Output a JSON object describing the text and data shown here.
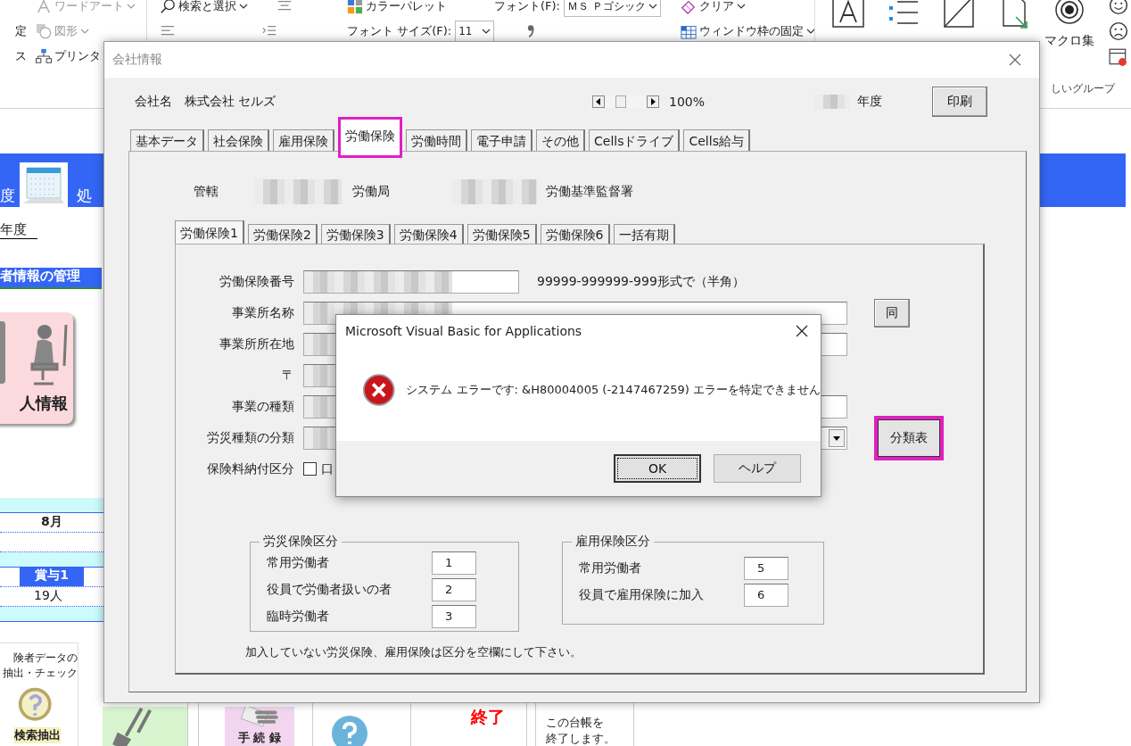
{
  "ribbon": {
    "cut_labels": [
      "定",
      "ス"
    ],
    "drawing_items": [
      {
        "kind": "wordart",
        "label": "ワードアート",
        "dropdown": true,
        "disabled": true
      },
      {
        "kind": "shapes",
        "label": "図形",
        "dropdown": true,
        "disabled": true
      },
      {
        "kind": "printer",
        "label": "プリンタ",
        "dropdown": false,
        "disabled": false
      }
    ],
    "search": "検索と選択",
    "palette": "カラーパレット",
    "font_label": "フォント(F):",
    "font_value": "ＭＳ Ｐゴシック",
    "size_label": "フォント サイズ(F):",
    "size_value": "11",
    "clear": "クリア",
    "freeze": "ウィンドウ枠の固定",
    "big_buttons": [
      {
        "kind": "letter"
      },
      {
        "kind": "list"
      },
      {
        "kind": "diagonal"
      },
      {
        "kind": "save"
      },
      {
        "kind": "target",
        "label": "マクロ集"
      }
    ],
    "group_label": "しいグループ"
  },
  "sheet": {
    "banner_left": "度",
    "banner_right": "処",
    "year": "年度",
    "section": "者情報の管理",
    "tile_caption": "人情報",
    "month": "8月",
    "bonus": "賞与1",
    "count": "19人",
    "search_tile": {
      "lines": [
        "険者データの",
        "抽出・チェック"
      ],
      "caption": "検索抽出"
    },
    "procedure_caption": "手 続 録",
    "end_title": "終了",
    "end_text": [
      "この台帳を",
      "終了します。"
    ]
  },
  "form": {
    "title": "会社情報",
    "company_label": "会社名",
    "company_name": "株式会社 セルズ",
    "zoom": "100%",
    "year_label": "年度",
    "print_button": "印刷",
    "tabs": [
      {
        "label": "基本データ",
        "selected": false,
        "highlighted": false
      },
      {
        "label": "社会保険",
        "selected": false,
        "highlighted": false
      },
      {
        "label": "雇用保険",
        "selected": false,
        "highlighted": false
      },
      {
        "label": "労働保険",
        "selected": true,
        "highlighted": true
      },
      {
        "label": "労働時間",
        "selected": false,
        "highlighted": false
      },
      {
        "label": "電子申請",
        "selected": false,
        "highlighted": false
      },
      {
        "label": "その他",
        "selected": false,
        "highlighted": false
      },
      {
        "label": "Cellsドライブ",
        "selected": false,
        "highlighted": false
      },
      {
        "label": "Cells給与",
        "selected": false,
        "highlighted": false
      }
    ],
    "jurisdiction": {
      "label": "管轄",
      "bureau": "労働局",
      "office": "労働基準監督署"
    },
    "sub_tabs": [
      {
        "label": "労働保険1",
        "selected": true
      },
      {
        "label": "労働保険2",
        "selected": false
      },
      {
        "label": "労働保険3",
        "selected": false
      },
      {
        "label": "労働保険4",
        "selected": false
      },
      {
        "label": "労働保険5",
        "selected": false
      },
      {
        "label": "労働保険6",
        "selected": false
      },
      {
        "label": "一括有期",
        "selected": false
      }
    ],
    "fields": [
      {
        "kind": "short",
        "label": "労働保険番号",
        "hint": "99999-999999-999形式で（半角）"
      },
      {
        "kind": "wide",
        "label": "事業所名称",
        "button": {
          "label": "同",
          "highlighted": false
        }
      },
      {
        "kind": "wide",
        "label": "事業所所在地"
      },
      {
        "kind": "postal",
        "label": "〒"
      },
      {
        "kind": "wide",
        "label": "事業の種類"
      },
      {
        "kind": "select",
        "label": "労災種類の分類",
        "button": {
          "label": "分類表",
          "highlighted": true
        }
      },
      {
        "kind": "checkbox",
        "label": "保険料納付区分",
        "option": "口",
        "checked": false
      }
    ],
    "groups": [
      {
        "title": "労災保険区分",
        "rows": [
          {
            "label": "常用労働者",
            "value": "1"
          },
          {
            "label": "役員で労働者扱いの者",
            "value": "2"
          },
          {
            "label": "臨時労働者",
            "value": "3"
          }
        ]
      },
      {
        "title": "雇用保険区分",
        "rows": [
          {
            "label": "常用労働者",
            "value": "5"
          },
          {
            "label": "役員で雇用保険に加入",
            "value": "6"
          }
        ]
      }
    ],
    "note": "加入していない労災保険、雇用保険は区分を空欄にして下さい。"
  },
  "dialog": {
    "title": "Microsoft Visual Basic for Applications",
    "message": "システム エラーです: &H80004005 (-2147467259) エラーを特定できません",
    "buttons": [
      {
        "label": "OK",
        "default": true
      },
      {
        "label": "ヘルプ",
        "default": false
      }
    ]
  }
}
